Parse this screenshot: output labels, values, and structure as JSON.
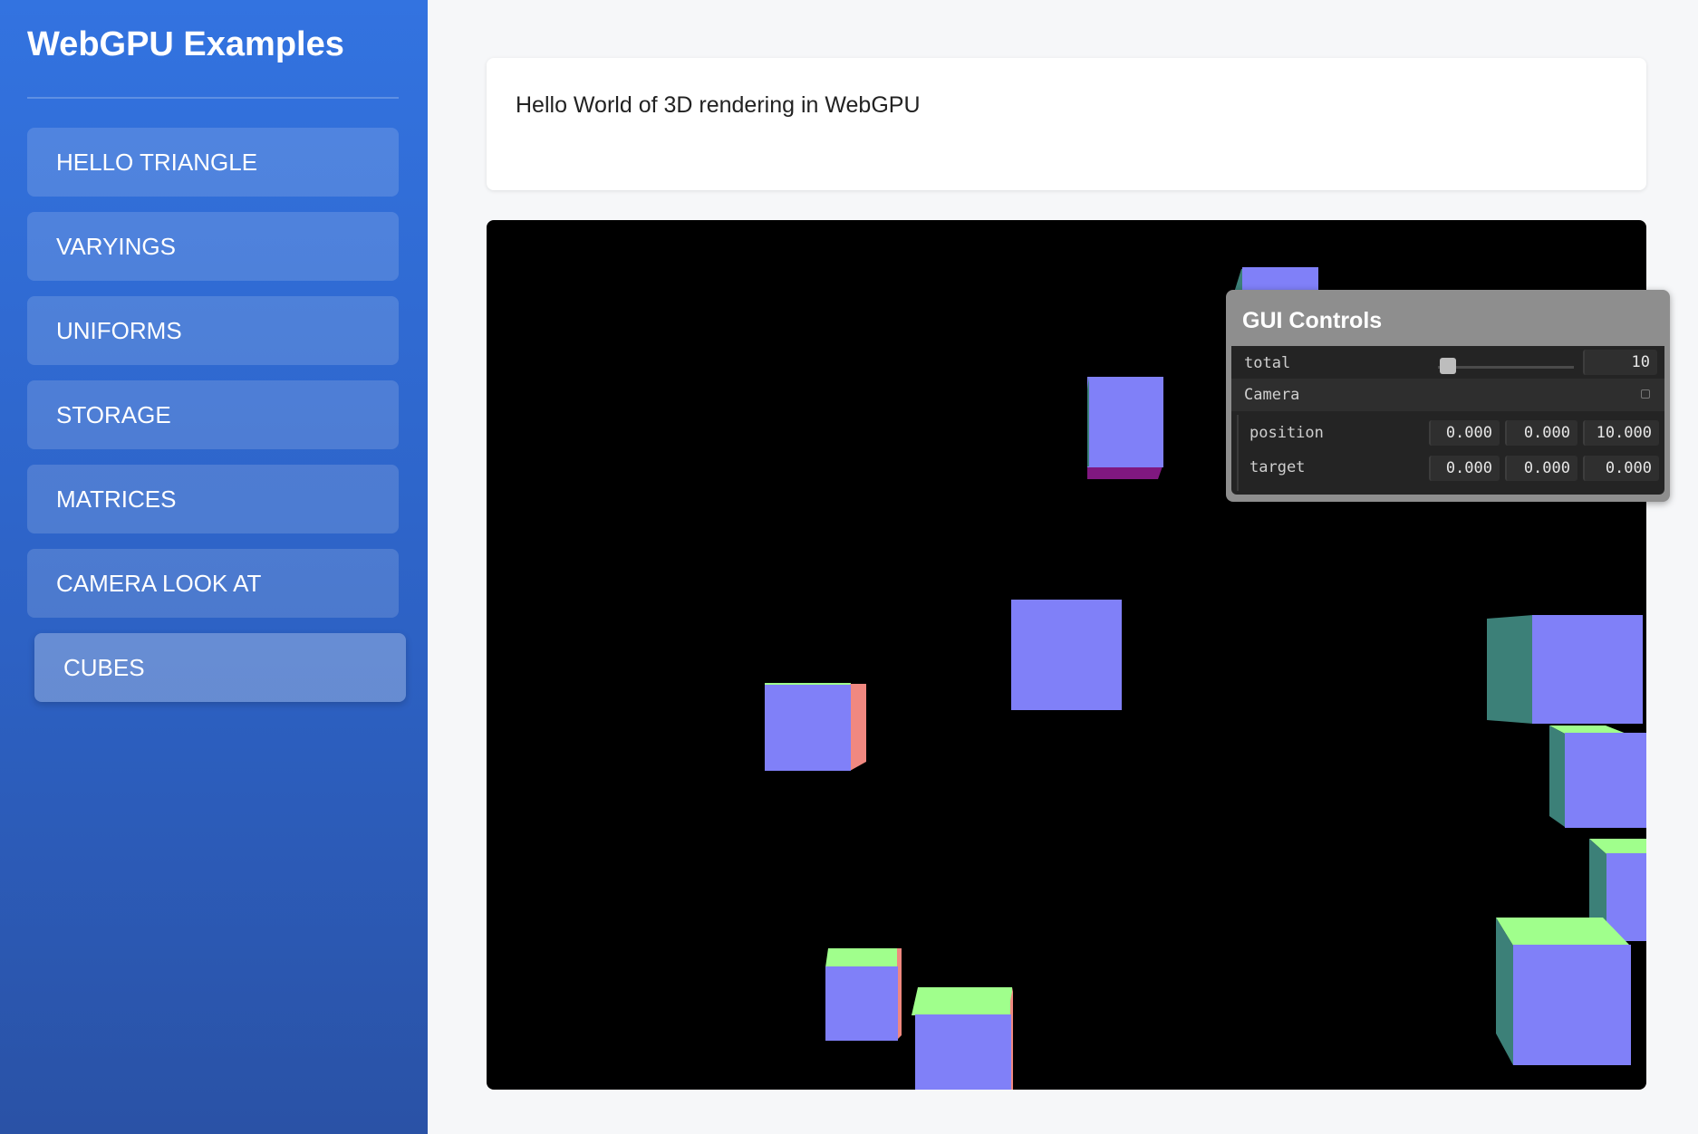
{
  "sidebar": {
    "title": "WebGPU Examples",
    "items": [
      {
        "label": "HELLO TRIANGLE"
      },
      {
        "label": "VARYINGS"
      },
      {
        "label": "UNIFORMS"
      },
      {
        "label": "STORAGE"
      },
      {
        "label": "MATRICES"
      },
      {
        "label": "CAMERA LOOK AT"
      },
      {
        "label": "CUBES"
      }
    ],
    "active_item": "CUBES"
  },
  "description": {
    "text": "Hello World of 3D rendering in WebGPU"
  },
  "gui": {
    "title": "GUI Controls",
    "total": {
      "label": "total",
      "value": "10"
    },
    "camera": {
      "label": "Camera",
      "position": {
        "label": "position",
        "x": "0.000",
        "y": "0.000",
        "z": "10.000"
      },
      "target": {
        "label": "target",
        "x": "0.000",
        "y": "0.000",
        "z": "0.000"
      }
    }
  },
  "colors": {
    "cube_front": "#8080f8",
    "cube_top": "#a0ff8c",
    "cube_side_left": "#3c8078",
    "cube_side_right": "#f08880",
    "cube_bottom": "#801880",
    "canvas_bg": "#000000",
    "sidebar_top": "#3373e0",
    "sidebar_bottom": "#2a52a6"
  }
}
